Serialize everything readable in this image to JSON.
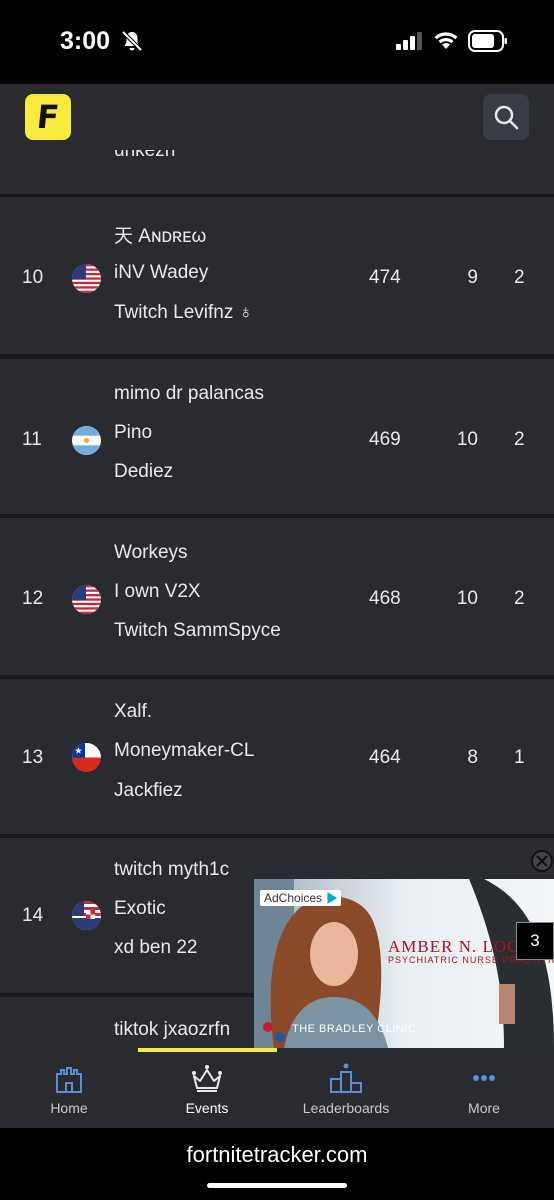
{
  "status_bar": {
    "time": "3:00"
  },
  "header": {
    "logo_letter": "F",
    "search_icon": "search-icon"
  },
  "list": {
    "cut_name": "uhkezh",
    "rows": [
      {
        "rank": "10",
        "flag": "us",
        "names": [
          "天 Aɴᴅʀᴇω",
          "iNV Wadey",
          "Twitch Levifnz ♁"
        ],
        "points": "474",
        "elims": "9",
        "wins": "2"
      },
      {
        "rank": "11",
        "flag": "ar",
        "names": [
          "mimo dr palancas",
          "Pino",
          "Dediez"
        ],
        "points": "469",
        "elims": "10",
        "wins": "2"
      },
      {
        "rank": "12",
        "flag": "us",
        "names": [
          "Workeys",
          "I own V2X",
          "Twitch SammSpyce"
        ],
        "points": "468",
        "elims": "10",
        "wins": "2"
      },
      {
        "rank": "13",
        "flag": "cl",
        "names": [
          "Xalf.",
          "Moneymaker-CL",
          "Jackfiez"
        ],
        "points": "464",
        "elims": "8",
        "wins": "1"
      },
      {
        "rank": "14",
        "flag": "mixed",
        "names": [
          "twitch myth1c",
          "Exotic",
          "xd ben 22"
        ],
        "points": "",
        "elims": "",
        "wins": ""
      },
      {
        "rank": "",
        "flag": "",
        "names": [
          "tiktok jxaozrfn"
        ],
        "points": "",
        "elims": "",
        "wins": ""
      }
    ]
  },
  "ad": {
    "adchoices": "AdChoices",
    "name": "AMBER N. LOCKM",
    "subtitle": "PSYCHIATRIC NURSE PRACTITIONER",
    "clinic": "THE BRADLEY CLINIC",
    "countdown": "3"
  },
  "tabs": [
    {
      "label": "Home",
      "icon": "castle-icon"
    },
    {
      "label": "Events",
      "icon": "crown-icon",
      "active": true
    },
    {
      "label": "Leaderboards",
      "icon": "podium-icon"
    },
    {
      "label": "More",
      "icon": "more-dots-icon"
    }
  ],
  "browser": {
    "url": "fortnitetracker.com"
  },
  "colors": {
    "accent": "#f7ec3e",
    "panel": "#2a2b31",
    "background": "#1a1b20",
    "tab_icon": "#5a8fd6"
  }
}
